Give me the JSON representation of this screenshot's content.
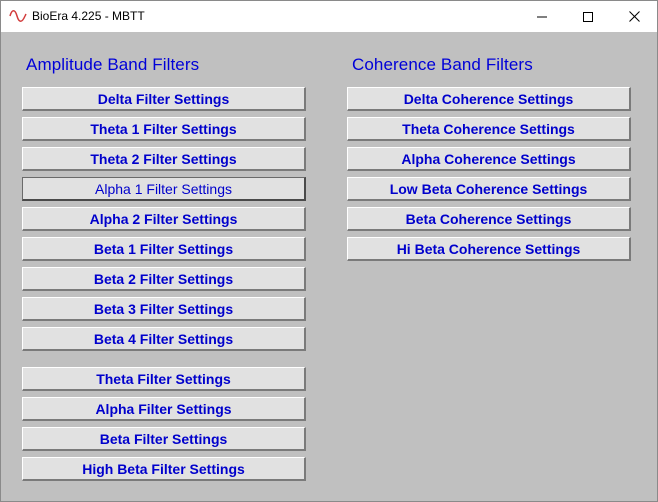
{
  "window": {
    "title": "BioEra 4.225 - MBTT",
    "app_icon": "sine-wave-icon",
    "controls": {
      "minimize": "minimize-icon",
      "maximize": "maximize-icon",
      "close": "close-icon"
    }
  },
  "amplitude": {
    "title": "Amplitude Band Filters",
    "buttons": [
      {
        "label": "Delta Filter Settings"
      },
      {
        "label": "Theta 1 Filter Settings"
      },
      {
        "label": "Theta 2 Filter Settings"
      },
      {
        "label": "Alpha 1 Filter Settings"
      },
      {
        "label": "Alpha 2 Filter Settings"
      },
      {
        "label": "Beta 1 Filter Settings"
      },
      {
        "label": "Beta 2 Filter Settings"
      },
      {
        "label": "Beta 3 Filter Settings"
      },
      {
        "label": "Beta 4 Filter Settings"
      },
      {
        "label": "Theta Filter Settings"
      },
      {
        "label": "Alpha Filter Settings"
      },
      {
        "label": "Beta Filter Settings"
      },
      {
        "label": "High Beta Filter Settings"
      }
    ]
  },
  "coherence": {
    "title": "Coherence Band Filters",
    "buttons": [
      {
        "label": "Delta Coherence Settings"
      },
      {
        "label": "Theta Coherence Settings"
      },
      {
        "label": "Alpha Coherence Settings"
      },
      {
        "label": "Low Beta Coherence Settings"
      },
      {
        "label": "Beta Coherence Settings"
      },
      {
        "label": "Hi Beta Coherence Settings"
      }
    ]
  },
  "colors": {
    "label_blue": "#0000cc",
    "panel_gray": "#c0c0c0",
    "button_face": "#e1e1e1",
    "icon_red": "#d23c3c"
  }
}
